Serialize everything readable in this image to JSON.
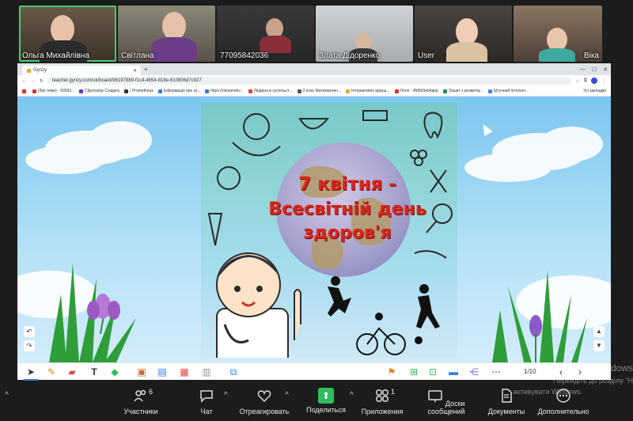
{
  "participants": [
    {
      "name": "Ольга Михайлівна"
    },
    {
      "name": "Світлана"
    },
    {
      "name": "77095842036"
    },
    {
      "name": "Злата Дідоренко"
    },
    {
      "name": "User"
    },
    {
      "name": "Віка"
    }
  ],
  "browser": {
    "tab_title": "Gynzy",
    "url": "teacher.gynzy.com/uk/board/96197889-f1c4-4654-818e-610806d7c927",
    "bookmarks": [
      {
        "label": "",
        "color": "#d93025"
      },
      {
        "label": "(без теми) - 09593...",
        "color": "#d93025"
      },
      {
        "label": "Clipchamp Создать",
        "color": "#5b3bb6"
      },
      {
        "label": "| Prometheus",
        "color": "#333333"
      },
      {
        "label": "Інформація про ку...",
        "color": "#2b7de9"
      },
      {
        "label": "https://olesandriv...",
        "color": "#2b7de9"
      },
      {
        "label": "Людина в суспільст...",
        "color": "#e0443b"
      },
      {
        "label": "3 клас Математичн...",
        "color": "#555555"
      },
      {
        "label": "Інтерактивні аркуш...",
        "color": "#f0a030"
      },
      {
        "label": "Логін - 4fd0d9eb4app",
        "color": "#d93025"
      },
      {
        "label": "Зошит з розвитку...",
        "color": "#2e8b57"
      },
      {
        "label": "Штучний інтелект...",
        "color": "#4285f4"
      }
    ],
    "all_bookmarks": "Усі закладки"
  },
  "poster": {
    "line1": "7 квітня -",
    "line2": "Всесвітній день",
    "line3": "здоров'я"
  },
  "board": {
    "page_indicator": "1/10"
  },
  "meeting_bar": {
    "participants_label": "Участники",
    "participants_count": "6",
    "chat_label": "Чат",
    "react_label": "Отреагировать",
    "share_label": "Поделиться",
    "apps_label": "Приложения",
    "apps_count": "1",
    "whiteboards_label": "Доски сообщений",
    "docs_label": "Документы",
    "more_label": "Дополнительно"
  },
  "windows_watermark": {
    "line1": "Активація Windows",
    "line2": "Перейдіть до розділу \"Н",
    "line3": "активувати Windows."
  },
  "colors": {
    "active_speaker": "#3fcf6b",
    "title_red": "#d9261c",
    "share_green": "#2dbd5a"
  }
}
